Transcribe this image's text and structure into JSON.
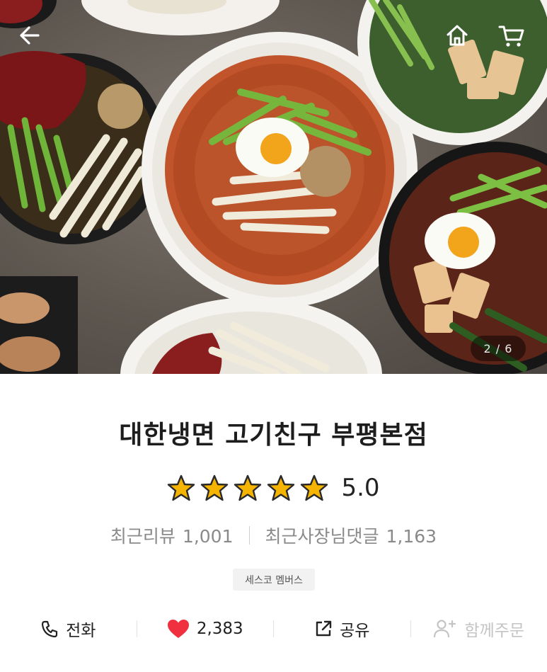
{
  "header": {
    "back_icon": "arrow-left-icon",
    "home_icon": "home-icon",
    "cart_icon": "cart-icon",
    "page_indicator": "2 / 6"
  },
  "store": {
    "name": "대한냉면 고기친구 부평본점",
    "rating": "5.0",
    "star_count": 5,
    "star_color": "#f5b400"
  },
  "stats": {
    "reviews_label": "최근리뷰",
    "reviews_count": "1,001",
    "owner_replies_label": "최근사장님댓글",
    "owner_replies_count": "1,163"
  },
  "badge": {
    "label": "세스코 멤버스"
  },
  "actions": {
    "call": {
      "label": "전화",
      "icon": "phone-icon"
    },
    "like": {
      "count": "2,383",
      "icon": "heart-icon",
      "color": "#f0303f"
    },
    "share": {
      "label": "공유",
      "icon": "share-icon"
    },
    "group_order": {
      "label": "함께주문",
      "icon": "add-person-icon",
      "disabled": true
    }
  }
}
